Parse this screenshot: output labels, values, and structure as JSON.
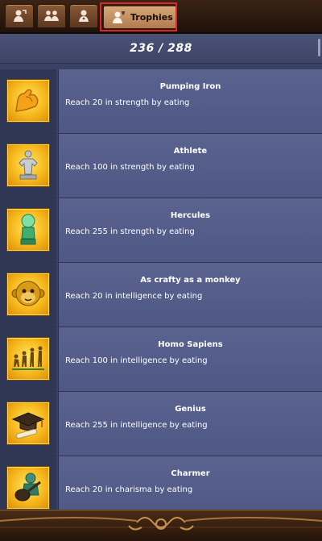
{
  "tabs": [
    {
      "icon": "character-icon"
    },
    {
      "icon": "group-icon"
    },
    {
      "icon": "profile-icon"
    },
    {
      "icon": "trophy-icon",
      "label": "Trophies",
      "active": true
    }
  ],
  "progress": {
    "text": "236 / 288",
    "earned": 236,
    "total": 288
  },
  "trophies": [
    {
      "icon": "flexed-arm-icon",
      "title": "Pumping Iron",
      "desc": "Reach 20 in strength by eating"
    },
    {
      "icon": "athlete-statue-icon",
      "title": "Athlete",
      "desc": "Reach 100 in strength by eating"
    },
    {
      "icon": "hercules-statue-icon",
      "title": "Hercules",
      "desc": "Reach 255 in strength by eating"
    },
    {
      "icon": "monkey-face-icon",
      "title": "As crafty as a monkey",
      "desc": "Reach 20 in intelligence by eating"
    },
    {
      "icon": "evolution-icon",
      "title": "Homo Sapiens",
      "desc": "Reach 100 in intelligence by eating"
    },
    {
      "icon": "graduation-cap-icon",
      "title": "Genius",
      "desc": "Reach 255 in intelligence by eating"
    },
    {
      "icon": "lute-player-icon",
      "title": "Charmer",
      "desc": "Reach 20 in charisma by eating"
    }
  ],
  "colors": {
    "highlight": "#e0262b",
    "icon_gold": "#f6b81c",
    "row_background": "#5a6390",
    "panel_background": "#3a4263"
  }
}
